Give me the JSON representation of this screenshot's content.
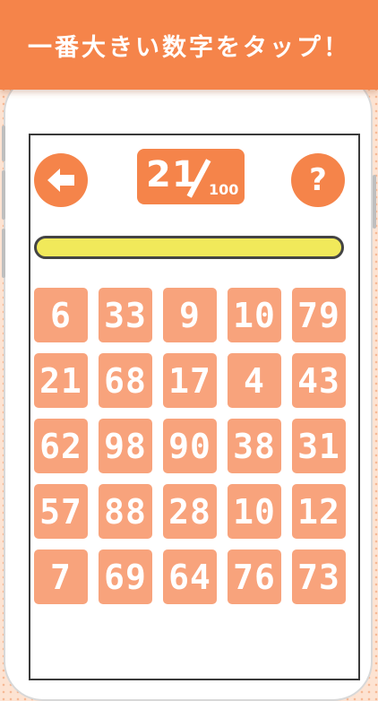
{
  "banner": {
    "text": "一番大きい数字をタップ！"
  },
  "header": {
    "current": "21",
    "total": "100",
    "back_icon": "arrow-left-icon",
    "help_icon": "question-icon",
    "help_glyph": "?"
  },
  "timer": {
    "fill_fraction": 1.0
  },
  "colors": {
    "accent": "#f5844a",
    "tile": "#f8a37c",
    "timer_fill": "#f1e95a",
    "timer_border": "#444444"
  },
  "grid": {
    "rows": [
      [
        "6",
        "33",
        "9",
        "10",
        "79"
      ],
      [
        "21",
        "68",
        "17",
        "4",
        "43"
      ],
      [
        "62",
        "98",
        "90",
        "38",
        "31"
      ],
      [
        "57",
        "88",
        "28",
        "10",
        "12"
      ],
      [
        "7",
        "69",
        "64",
        "76",
        "73"
      ]
    ]
  }
}
